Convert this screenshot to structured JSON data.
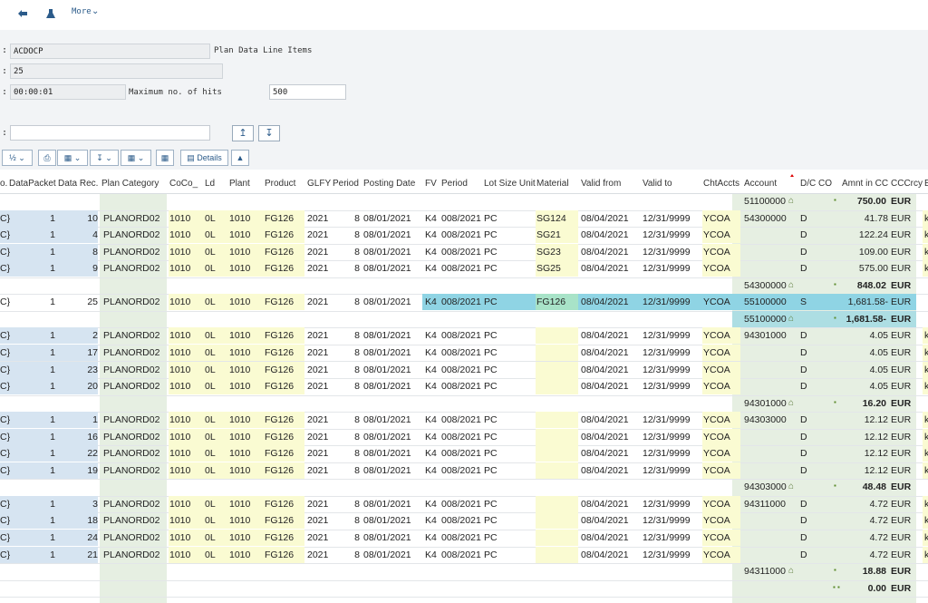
{
  "toolbar": {
    "more_label": "More"
  },
  "form": {
    "table_value": "ACDOCP",
    "table_desc": "Plan Data Line Items",
    "hits_value": "25",
    "runtime_value": "00:00:01",
    "max_hits_label": "Maximum no. of hits",
    "max_hits_value": "500",
    "extra_value": ""
  },
  "alv_toolbar": {
    "details_label": "Details"
  },
  "columns": [
    "o.",
    "DataPacket",
    "Data Rec.",
    "Plan Category",
    "CoCo_",
    "Ld",
    "Plant",
    "Product",
    "GLFY",
    "Period",
    "Posting Date",
    "FV",
    "Period",
    "Lot Size Unit",
    "Material",
    "Valid from",
    "Valid to",
    "ChtAccts",
    "Account",
    "D/C CO",
    "Amnt in CC",
    "CCCrcy",
    "E"
  ],
  "rows": [
    {
      "type": "sub",
      "account": "51100000",
      "amount": "750.00",
      "currency": "EUR"
    },
    {
      "type": "data",
      "grp": "1",
      "c0": "C}",
      "packet": "1",
      "rec": "10",
      "category": "PLANORD02",
      "coco": "1010",
      "ld": "0L",
      "plant": "1010",
      "product": "FG126",
      "glfy": "2021",
      "period": "8",
      "posting_date": "08/01/2021",
      "fv": "K4",
      "fperiod": "008/2021",
      "lot": "PC",
      "material": "SG124",
      "valid_from": "08/04/2021",
      "valid_to": "12/31/9999",
      "chtaccts": "YCOA",
      "account": "54300000",
      "dc": "D",
      "amount": "41.78",
      "currency": "EUR",
      "e": "k"
    },
    {
      "type": "data",
      "grp": "1",
      "c0": "C}",
      "packet": "1",
      "rec": "4",
      "category": "PLANORD02",
      "coco": "1010",
      "ld": "0L",
      "plant": "1010",
      "product": "FG126",
      "glfy": "2021",
      "period": "8",
      "posting_date": "08/01/2021",
      "fv": "K4",
      "fperiod": "008/2021",
      "lot": "PC",
      "material": "SG21",
      "valid_from": "08/04/2021",
      "valid_to": "12/31/9999",
      "chtaccts": "YCOA",
      "account": "",
      "dc": "D",
      "amount": "122.24",
      "currency": "EUR",
      "e": "k"
    },
    {
      "type": "data",
      "grp": "1",
      "c0": "C}",
      "packet": "1",
      "rec": "8",
      "category": "PLANORD02",
      "coco": "1010",
      "ld": "0L",
      "plant": "1010",
      "product": "FG126",
      "glfy": "2021",
      "period": "8",
      "posting_date": "08/01/2021",
      "fv": "K4",
      "fperiod": "008/2021",
      "lot": "PC",
      "material": "SG23",
      "valid_from": "08/04/2021",
      "valid_to": "12/31/9999",
      "chtaccts": "YCOA",
      "account": "",
      "dc": "D",
      "amount": "109.00",
      "currency": "EUR",
      "e": "k"
    },
    {
      "type": "data",
      "grp": "1",
      "c0": "C}",
      "packet": "1",
      "rec": "9",
      "category": "PLANORD02",
      "coco": "1010",
      "ld": "0L",
      "plant": "1010",
      "product": "FG126",
      "glfy": "2021",
      "period": "8",
      "posting_date": "08/01/2021",
      "fv": "K4",
      "fperiod": "008/2021",
      "lot": "PC",
      "material": "SG25",
      "valid_from": "08/04/2021",
      "valid_to": "12/31/9999",
      "chtaccts": "YCOA",
      "account": "",
      "dc": "D",
      "amount": "575.00",
      "currency": "EUR",
      "e": "k"
    },
    {
      "type": "sub",
      "account": "54300000",
      "amount": "848.02",
      "currency": "EUR"
    },
    {
      "type": "data",
      "grp": "2",
      "c0": "C}",
      "packet": "1",
      "rec": "25",
      "category": "PLANORD02",
      "coco": "1010",
      "ld": "0L",
      "plant": "1010",
      "product": "FG126",
      "glfy": "2021",
      "period": "8",
      "posting_date": "08/01/2021",
      "fv": "K4",
      "fperiod": "008/2021",
      "lot": "PC",
      "material": "FG126",
      "valid_from": "08/04/2021",
      "valid_to": "12/31/9999",
      "chtaccts": "YCOA",
      "account": "55100000",
      "dc": "S",
      "amount": "1,681.58-",
      "currency": "EUR",
      "e": ""
    },
    {
      "type": "sub",
      "account": "55100000",
      "amount": "1,681.58-",
      "currency": "EUR"
    },
    {
      "type": "data",
      "grp": "1",
      "c0": "C}",
      "packet": "1",
      "rec": "2",
      "category": "PLANORD02",
      "coco": "1010",
      "ld": "0L",
      "plant": "1010",
      "product": "FG126",
      "glfy": "2021",
      "period": "8",
      "posting_date": "08/01/2021",
      "fv": "K4",
      "fperiod": "008/2021",
      "lot": "PC",
      "material": "",
      "valid_from": "08/04/2021",
      "valid_to": "12/31/9999",
      "chtaccts": "YCOA",
      "account": "94301000",
      "dc": "D",
      "amount": "4.05",
      "currency": "EUR",
      "e": "k"
    },
    {
      "type": "data",
      "grp": "1",
      "c0": "C}",
      "packet": "1",
      "rec": "17",
      "category": "PLANORD02",
      "coco": "1010",
      "ld": "0L",
      "plant": "1010",
      "product": "FG126",
      "glfy": "2021",
      "period": "8",
      "posting_date": "08/01/2021",
      "fv": "K4",
      "fperiod": "008/2021",
      "lot": "PC",
      "material": "",
      "valid_from": "08/04/2021",
      "valid_to": "12/31/9999",
      "chtaccts": "YCOA",
      "account": "",
      "dc": "D",
      "amount": "4.05",
      "currency": "EUR",
      "e": "k"
    },
    {
      "type": "data",
      "grp": "1",
      "c0": "C}",
      "packet": "1",
      "rec": "23",
      "category": "PLANORD02",
      "coco": "1010",
      "ld": "0L",
      "plant": "1010",
      "product": "FG126",
      "glfy": "2021",
      "period": "8",
      "posting_date": "08/01/2021",
      "fv": "K4",
      "fperiod": "008/2021",
      "lot": "PC",
      "material": "",
      "valid_from": "08/04/2021",
      "valid_to": "12/31/9999",
      "chtaccts": "YCOA",
      "account": "",
      "dc": "D",
      "amount": "4.05",
      "currency": "EUR",
      "e": "k"
    },
    {
      "type": "data",
      "grp": "1",
      "c0": "C}",
      "packet": "1",
      "rec": "20",
      "category": "PLANORD02",
      "coco": "1010",
      "ld": "0L",
      "plant": "1010",
      "product": "FG126",
      "glfy": "2021",
      "period": "8",
      "posting_date": "08/01/2021",
      "fv": "K4",
      "fperiod": "008/2021",
      "lot": "PC",
      "material": "",
      "valid_from": "08/04/2021",
      "valid_to": "12/31/9999",
      "chtaccts": "YCOA",
      "account": "",
      "dc": "D",
      "amount": "4.05",
      "currency": "EUR",
      "e": "k"
    },
    {
      "type": "sub",
      "account": "94301000",
      "amount": "16.20",
      "currency": "EUR"
    },
    {
      "type": "data",
      "grp": "1",
      "c0": "C}",
      "packet": "1",
      "rec": "1",
      "category": "PLANORD02",
      "coco": "1010",
      "ld": "0L",
      "plant": "1010",
      "product": "FG126",
      "glfy": "2021",
      "period": "8",
      "posting_date": "08/01/2021",
      "fv": "K4",
      "fperiod": "008/2021",
      "lot": "PC",
      "material": "",
      "valid_from": "08/04/2021",
      "valid_to": "12/31/9999",
      "chtaccts": "YCOA",
      "account": "94303000",
      "dc": "D",
      "amount": "12.12",
      "currency": "EUR",
      "e": "k"
    },
    {
      "type": "data",
      "grp": "1",
      "c0": "C}",
      "packet": "1",
      "rec": "16",
      "category": "PLANORD02",
      "coco": "1010",
      "ld": "0L",
      "plant": "1010",
      "product": "FG126",
      "glfy": "2021",
      "period": "8",
      "posting_date": "08/01/2021",
      "fv": "K4",
      "fperiod": "008/2021",
      "lot": "PC",
      "material": "",
      "valid_from": "08/04/2021",
      "valid_to": "12/31/9999",
      "chtaccts": "YCOA",
      "account": "",
      "dc": "D",
      "amount": "12.12",
      "currency": "EUR",
      "e": "k"
    },
    {
      "type": "data",
      "grp": "1",
      "c0": "C}",
      "packet": "1",
      "rec": "22",
      "category": "PLANORD02",
      "coco": "1010",
      "ld": "0L",
      "plant": "1010",
      "product": "FG126",
      "glfy": "2021",
      "period": "8",
      "posting_date": "08/01/2021",
      "fv": "K4",
      "fperiod": "008/2021",
      "lot": "PC",
      "material": "",
      "valid_from": "08/04/2021",
      "valid_to": "12/31/9999",
      "chtaccts": "YCOA",
      "account": "",
      "dc": "D",
      "amount": "12.12",
      "currency": "EUR",
      "e": "k"
    },
    {
      "type": "data",
      "grp": "1",
      "c0": "C}",
      "packet": "1",
      "rec": "19",
      "category": "PLANORD02",
      "coco": "1010",
      "ld": "0L",
      "plant": "1010",
      "product": "FG126",
      "glfy": "2021",
      "period": "8",
      "posting_date": "08/01/2021",
      "fv": "K4",
      "fperiod": "008/2021",
      "lot": "PC",
      "material": "",
      "valid_from": "08/04/2021",
      "valid_to": "12/31/9999",
      "chtaccts": "YCOA",
      "account": "",
      "dc": "D",
      "amount": "12.12",
      "currency": "EUR",
      "e": "k"
    },
    {
      "type": "sub",
      "account": "94303000",
      "amount": "48.48",
      "currency": "EUR"
    },
    {
      "type": "data",
      "grp": "1",
      "c0": "C}",
      "packet": "1",
      "rec": "3",
      "category": "PLANORD02",
      "coco": "1010",
      "ld": "0L",
      "plant": "1010",
      "product": "FG126",
      "glfy": "2021",
      "period": "8",
      "posting_date": "08/01/2021",
      "fv": "K4",
      "fperiod": "008/2021",
      "lot": "PC",
      "material": "",
      "valid_from": "08/04/2021",
      "valid_to": "12/31/9999",
      "chtaccts": "YCOA",
      "account": "94311000",
      "dc": "D",
      "amount": "4.72",
      "currency": "EUR",
      "e": "k"
    },
    {
      "type": "data",
      "grp": "1",
      "c0": "C}",
      "packet": "1",
      "rec": "18",
      "category": "PLANORD02",
      "coco": "1010",
      "ld": "0L",
      "plant": "1010",
      "product": "FG126",
      "glfy": "2021",
      "period": "8",
      "posting_date": "08/01/2021",
      "fv": "K4",
      "fperiod": "008/2021",
      "lot": "PC",
      "material": "",
      "valid_from": "08/04/2021",
      "valid_to": "12/31/9999",
      "chtaccts": "YCOA",
      "account": "",
      "dc": "D",
      "amount": "4.72",
      "currency": "EUR",
      "e": "k"
    },
    {
      "type": "data",
      "grp": "1",
      "c0": "C}",
      "packet": "1",
      "rec": "24",
      "category": "PLANORD02",
      "coco": "1010",
      "ld": "0L",
      "plant": "1010",
      "product": "FG126",
      "glfy": "2021",
      "period": "8",
      "posting_date": "08/01/2021",
      "fv": "K4",
      "fperiod": "008/2021",
      "lot": "PC",
      "material": "",
      "valid_from": "08/04/2021",
      "valid_to": "12/31/9999",
      "chtaccts": "YCOA",
      "account": "",
      "dc": "D",
      "amount": "4.72",
      "currency": "EUR",
      "e": "k"
    },
    {
      "type": "data",
      "grp": "1",
      "c0": "C}",
      "packet": "1",
      "rec": "21",
      "category": "PLANORD02",
      "coco": "1010",
      "ld": "0L",
      "plant": "1010",
      "product": "FG126",
      "glfy": "2021",
      "period": "8",
      "posting_date": "08/01/2021",
      "fv": "K4",
      "fperiod": "008/2021",
      "lot": "PC",
      "material": "",
      "valid_from": "08/04/2021",
      "valid_to": "12/31/9999",
      "chtaccts": "YCOA",
      "account": "",
      "dc": "D",
      "amount": "4.72",
      "currency": "EUR",
      "e": "k"
    },
    {
      "type": "sub",
      "account": "94311000",
      "amount": "18.88",
      "currency": "EUR"
    },
    {
      "type": "total",
      "account": "",
      "amount": "0.00",
      "currency": "EUR"
    }
  ],
  "colors": {
    "key_blue": "#d6e4f1",
    "yellow": "#fafbd2",
    "green": "#e6efe2",
    "selected": "#8fd4e4",
    "header_bg": "#ffffff"
  }
}
